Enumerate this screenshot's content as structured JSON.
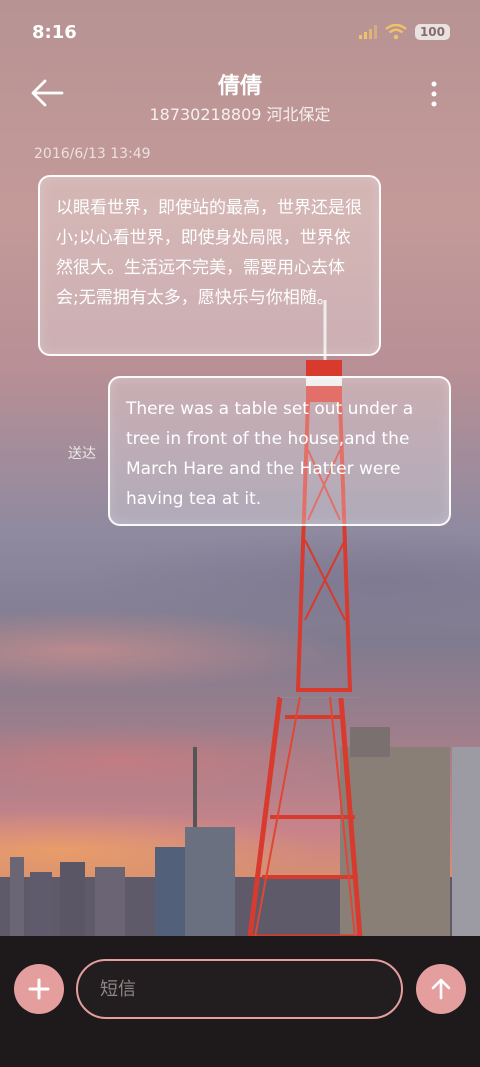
{
  "status_bar": {
    "time": "8:16",
    "battery": "100"
  },
  "header": {
    "title": "倩倩",
    "subtitle": "18730218809 河北保定"
  },
  "conversation": {
    "date": "2016/6/13 13:49",
    "incoming_message": "以眼看世界，即使站的最高，世界还是很小;以心看世界，即使身处局限，世界依然很大。生活远不完美，需要用心去体会;无需拥有太多，愿快乐与你相随。",
    "outgoing_message": "There was a table set out under a tree in front of the house,and the March Hare and the Hatter were having tea at it.",
    "delivery_status": "送达"
  },
  "composer": {
    "placeholder": "短信",
    "value": ""
  },
  "colors": {
    "accent": "#e59e9e",
    "bottom_bar": "#1e1a1b"
  },
  "icons": {
    "back": "arrow-left-icon",
    "more": "more-vertical-icon",
    "add": "plus-icon",
    "send": "arrow-up-icon"
  }
}
